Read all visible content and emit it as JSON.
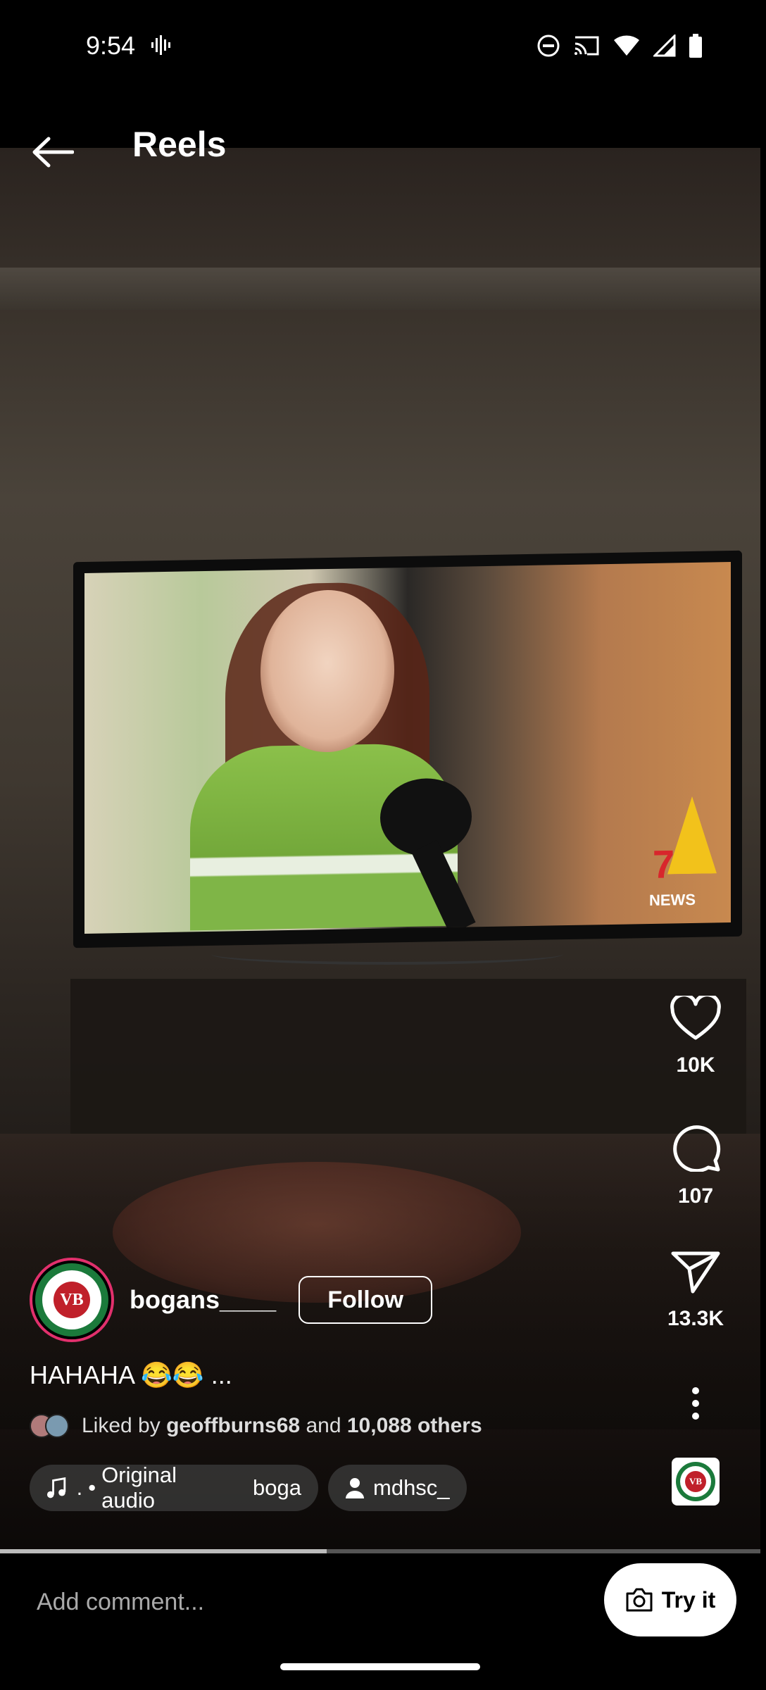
{
  "status_bar": {
    "time": "9:54",
    "icons": [
      "voice-activity-icon",
      "do-not-disturb-icon",
      "cast-icon",
      "wifi-icon",
      "signal-icon",
      "battery-icon"
    ]
  },
  "header": {
    "title": "Reels"
  },
  "video": {
    "news_logo": "NEWS",
    "news_number": "7",
    "progress": 0.43
  },
  "actions": {
    "likes": "10K",
    "comments": "107",
    "shares": "13.3K"
  },
  "post": {
    "username": "bogans____",
    "follow_label": "Follow",
    "caption": "HAHAHA 😂😂 ...",
    "liked_by_prefix": "Liked by",
    "liked_by_user": "geoffburns68",
    "liked_by_and": "and",
    "liked_by_others": "10,088 others",
    "avatar_text": "VB",
    "audio_chip": {
      "dot": ".",
      "label": "Original audio",
      "owner": "boga"
    },
    "tagged_user": "mdhsc_"
  },
  "bottom": {
    "comment_placeholder": "Add comment...",
    "try_label": "Try it"
  },
  "colors": {
    "background": "#000000",
    "avatar_ring": "#e1306c",
    "vb_green": "#1b7a3b",
    "vb_red": "#c0202a"
  }
}
